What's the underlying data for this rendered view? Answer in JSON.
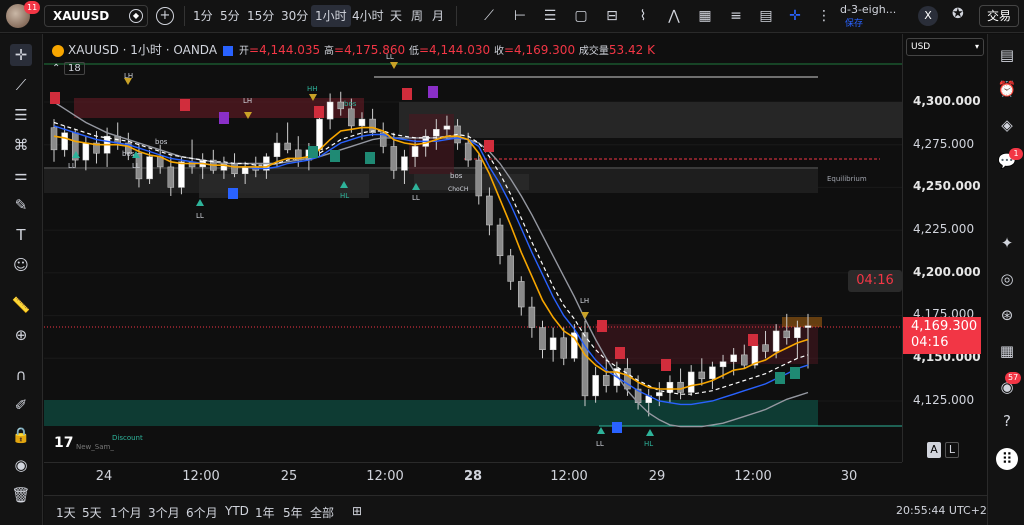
{
  "top_bar": {
    "avatar_badge": "11",
    "symbol": "XAUUSD",
    "timeframes": [
      "1分",
      "5分",
      "15分",
      "30分",
      "1小时",
      "4小时",
      "天",
      "周",
      "月"
    ],
    "active_timeframe": "1小时",
    "layout_name": "d-3-eigh...",
    "layout_status": "保存",
    "close": "X",
    "trade_button": "交易"
  },
  "legend": {
    "symbol_line": "XAUUSD · 1小时 · OANDA",
    "open_label": "开",
    "open": "=4,144.035",
    "high_label": "高",
    "high": "=4,175.860",
    "low_label": "低",
    "low": "=4,144.030",
    "close_label": "收",
    "close": "=4,169.300",
    "volume_label": "成交量",
    "volume": "53.42 K",
    "indicator_count": "18"
  },
  "price_axis": {
    "currency": "USD",
    "labels": [
      "4,300.000",
      "4,275.000",
      "4,250.000",
      "4,225.000",
      "4,200.000",
      "4,175.000",
      "4,150.000",
      "4,125.000"
    ],
    "current_price": "4,169.300",
    "current_countdown": "04:16"
  },
  "countdown_tag": "04:16",
  "time_axis": {
    "labels": [
      "24",
      "12:00",
      "25",
      "12:00",
      "28",
      "12:00",
      "29",
      "12:00",
      "30"
    ]
  },
  "chart_text": {
    "equilibrium": "Equilibrium",
    "discount": "Discount",
    "author": "New_Sam_",
    "tv_logo": "17",
    "bos_labels": [
      "bos",
      "bos",
      "bos",
      "bos"
    ],
    "choch_label": "ChoCH",
    "swing_labels": [
      "LH",
      "LL",
      "LL",
      "LL",
      "HH",
      "HL",
      "LH",
      "LL",
      "LH",
      "LL",
      "HL",
      "LL"
    ]
  },
  "scale_buttons": {
    "auto": "A",
    "log": "L"
  },
  "bottom_bar": {
    "ranges": [
      "1天",
      "5天",
      "1个月",
      "3个月",
      "6个月",
      "YTD",
      "1年",
      "5年",
      "全部"
    ],
    "clock": "20:55:44 UTC+2"
  },
  "right_toolbar": {
    "chat_badge": "1",
    "notif_badge": "57"
  },
  "colors": {
    "bull": "#e8e8e8",
    "bear": "#e8e8e8",
    "accent_red": "#f23645",
    "ma_orange": "#f7a600",
    "ma_blue": "#2962ff",
    "ma_gray": "#9598a1",
    "zone_green": "#0f4f45",
    "zone_red": "#5a1a22"
  },
  "chart_data": {
    "type": "candlestick",
    "symbol": "XAUUSD",
    "interval": "1小时",
    "ylim": [
      4105,
      4320
    ],
    "categories": [
      "24",
      "12:00",
      "25",
      "12:00",
      "28",
      "12:00",
      "29",
      "12:00",
      "30"
    ],
    "ohlc": [
      [
        4285,
        4290,
        4265,
        4272
      ],
      [
        4272,
        4286,
        4268,
        4282
      ],
      [
        4282,
        4284,
        4262,
        4266
      ],
      [
        4266,
        4280,
        4260,
        4276
      ],
      [
        4276,
        4283,
        4264,
        4270
      ],
      [
        4270,
        4285,
        4262,
        4280
      ],
      [
        4280,
        4288,
        4272,
        4276
      ],
      [
        4276,
        4282,
        4266,
        4270
      ],
      [
        4270,
        4276,
        4250,
        4255
      ],
      [
        4255,
        4272,
        4252,
        4268
      ],
      [
        4268,
        4275,
        4258,
        4262
      ],
      [
        4262,
        4268,
        4245,
        4250
      ],
      [
        4250,
        4268,
        4246,
        4265
      ],
      [
        4265,
        4278,
        4258,
        4262
      ],
      [
        4262,
        4270,
        4255,
        4266
      ],
      [
        4266,
        4272,
        4258,
        4260
      ],
      [
        4260,
        4268,
        4255,
        4264
      ],
      [
        4264,
        4270,
        4256,
        4258
      ],
      [
        4258,
        4265,
        4252,
        4262
      ],
      [
        4262,
        4268,
        4256,
        4260
      ],
      [
        4260,
        4270,
        4255,
        4268
      ],
      [
        4268,
        4282,
        4262,
        4276
      ],
      [
        4276,
        4288,
        4270,
        4272
      ],
      [
        4272,
        4280,
        4262,
        4266
      ],
      [
        4266,
        4276,
        4260,
        4272
      ],
      [
        4272,
        4295,
        4268,
        4290
      ],
      [
        4290,
        4305,
        4284,
        4300
      ],
      [
        4300,
        4306,
        4292,
        4296
      ],
      [
        4296,
        4302,
        4282,
        4286
      ],
      [
        4286,
        4294,
        4278,
        4290
      ],
      [
        4290,
        4296,
        4280,
        4282
      ],
      [
        4282,
        4288,
        4270,
        4274
      ],
      [
        4274,
        4282,
        4255,
        4260
      ],
      [
        4260,
        4272,
        4252,
        4268
      ],
      [
        4268,
        4278,
        4262,
        4274
      ],
      [
        4274,
        4284,
        4268,
        4280
      ],
      [
        4280,
        4290,
        4272,
        4284
      ],
      [
        4284,
        4292,
        4278,
        4286
      ],
      [
        4286,
        4290,
        4272,
        4276
      ],
      [
        4276,
        4282,
        4262,
        4266
      ],
      [
        4266,
        4270,
        4240,
        4245
      ],
      [
        4245,
        4250,
        4222,
        4228
      ],
      [
        4228,
        4232,
        4205,
        4210
      ],
      [
        4210,
        4214,
        4190,
        4195
      ],
      [
        4195,
        4198,
        4175,
        4180
      ],
      [
        4180,
        4186,
        4162,
        4168
      ],
      [
        4168,
        4172,
        4150,
        4155
      ],
      [
        4155,
        4168,
        4148,
        4162
      ],
      [
        4162,
        4168,
        4146,
        4150
      ],
      [
        4150,
        4170,
        4148,
        4165
      ],
      [
        4165,
        4172,
        4122,
        4128
      ],
      [
        4128,
        4145,
        4124,
        4140
      ],
      [
        4140,
        4150,
        4130,
        4134
      ],
      [
        4134,
        4148,
        4130,
        4144
      ],
      [
        4144,
        4150,
        4128,
        4132
      ],
      [
        4132,
        4140,
        4120,
        4124
      ],
      [
        4124,
        4132,
        4116,
        4128
      ],
      [
        4128,
        4136,
        4122,
        4130
      ],
      [
        4130,
        4140,
        4124,
        4136
      ],
      [
        4136,
        4144,
        4126,
        4130
      ],
      [
        4130,
        4146,
        4128,
        4142
      ],
      [
        4142,
        4150,
        4134,
        4138
      ],
      [
        4138,
        4148,
        4132,
        4145
      ],
      [
        4145,
        4152,
        4138,
        4148
      ],
      [
        4148,
        4156,
        4140,
        4152
      ],
      [
        4152,
        4158,
        4144,
        4146
      ],
      [
        4146,
        4162,
        4144,
        4158
      ],
      [
        4158,
        4166,
        4150,
        4154
      ],
      [
        4154,
        4170,
        4150,
        4166
      ],
      [
        4166,
        4176,
        4158,
        4162
      ],
      [
        4162,
        4172,
        4150,
        4168
      ],
      [
        4168,
        4176,
        4144,
        4169
      ]
    ],
    "ma_fast": [
      4280,
      4279,
      4277,
      4276,
      4275,
      4275,
      4275,
      4274,
      4271,
      4269,
      4268,
      4265,
      4264,
      4264,
      4264,
      4263,
      4263,
      4262,
      4262,
      4262,
      4262,
      4265,
      4267,
      4267,
      4268,
      4272,
      4278,
      4283,
      4284,
      4285,
      4285,
      4283,
      4278,
      4276,
      4275,
      4276,
      4278,
      4280,
      4280,
      4278,
      4270,
      4258,
      4243,
      4228,
      4212,
      4198,
      4184,
      4174,
      4166,
      4162,
      4152,
      4146,
      4142,
      4142,
      4140,
      4136,
      4133,
      4132,
      4132,
      4132,
      4134,
      4135,
      4137,
      4140,
      4143,
      4144,
      4147,
      4149,
      4153,
      4156,
      4159,
      4161
    ],
    "ma_mid": [
      4288,
      4286,
      4284,
      4282,
      4280,
      4279,
      4278,
      4277,
      4275,
      4273,
      4271,
      4269,
      4268,
      4267,
      4266,
      4265,
      4265,
      4264,
      4264,
      4263,
      4263,
      4264,
      4266,
      4267,
      4268,
      4270,
      4274,
      4278,
      4280,
      4282,
      4283,
      4283,
      4281,
      4280,
      4279,
      4279,
      4279,
      4280,
      4281,
      4280,
      4276,
      4268,
      4258,
      4246,
      4232,
      4218,
      4205,
      4192,
      4181,
      4173,
      4163,
      4155,
      4149,
      4145,
      4141,
      4137,
      4134,
      4131,
      4130,
      4129,
      4129,
      4130,
      4131,
      4133,
      4135,
      4137,
      4139,
      4141,
      4144,
      4147,
      4150,
      4152
    ],
    "ma_slow": [
      4300,
      4296,
      4292,
      4288,
      4285,
      4282,
      4280,
      4278,
      4276,
      4274,
      4272,
      4270,
      4268,
      4267,
      4266,
      4265,
      4264,
      4264,
      4264,
      4264,
      4264,
      4264,
      4265,
      4266,
      4267,
      4268,
      4270,
      4272,
      4274,
      4276,
      4278,
      4279,
      4279,
      4279,
      4279,
      4279,
      4279,
      4279,
      4279,
      4278,
      4276,
      4271,
      4264,
      4255,
      4245,
      4234,
      4222,
      4210,
      4198,
      4186,
      4173,
      4161,
      4150,
      4140,
      4131,
      4124,
      4118,
      4114,
      4111,
      4110,
      4110,
      4110,
      4111,
      4112,
      4114,
      4116,
      4118,
      4120,
      4123,
      4126,
      4128,
      4130
    ]
  }
}
